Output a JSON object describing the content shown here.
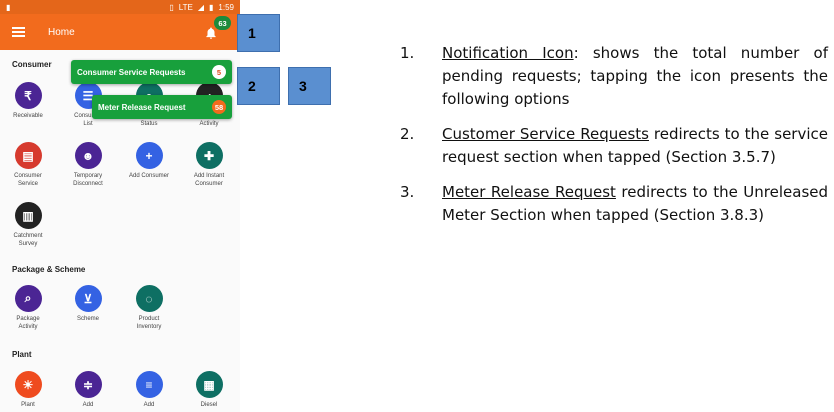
{
  "status_bar": {
    "time": "1:59",
    "network": "LTE"
  },
  "app_bar": {
    "title": "Home",
    "notification_count": "63"
  },
  "sections": {
    "consumer": "Consumer",
    "package_scheme": "Package & Scheme",
    "plant": "Plant"
  },
  "tiles": {
    "receivable": "Receivable",
    "consumer_list": "Consumer\nList",
    "consumer_status": "Consumer\nStatus",
    "consumer_activity": "Consumer\nActivity",
    "consumer_service": "Consumer\nService",
    "temporary_disconnect": "Temporary\nDisconnect",
    "add_consumer": "Add Consumer",
    "add_instant_consumer": "Add Instant\nConsumer",
    "catchment_survey": "Catchment\nSurvey",
    "package_activity": "Package\nActivity",
    "scheme": "Scheme",
    "product_inventory": "Product\nInventory",
    "plant": "Plant",
    "add_1": "Add",
    "add_2": "Add",
    "diesel": "Diesel"
  },
  "popup": {
    "service_requests": {
      "label": "Consumer Service Requests",
      "count": "5"
    },
    "meter_release": {
      "label": "Meter Release Request",
      "count": "58"
    }
  },
  "callouts": [
    "1",
    "2",
    "3"
  ],
  "notes": [
    {
      "num": "1.",
      "key": "Notification Icon",
      "text": ": shows the total number of pending requests; tapping the icon presents the following options"
    },
    {
      "num": "2.",
      "key": "Customer Service Requests",
      "text": " redirects to the service request section when tapped (Section 3.5.7)"
    },
    {
      "num": "3.",
      "key": "Meter Release Request",
      "text": " redirects to the Unreleased Meter Section when tapped (Section 3.8.3)"
    }
  ]
}
